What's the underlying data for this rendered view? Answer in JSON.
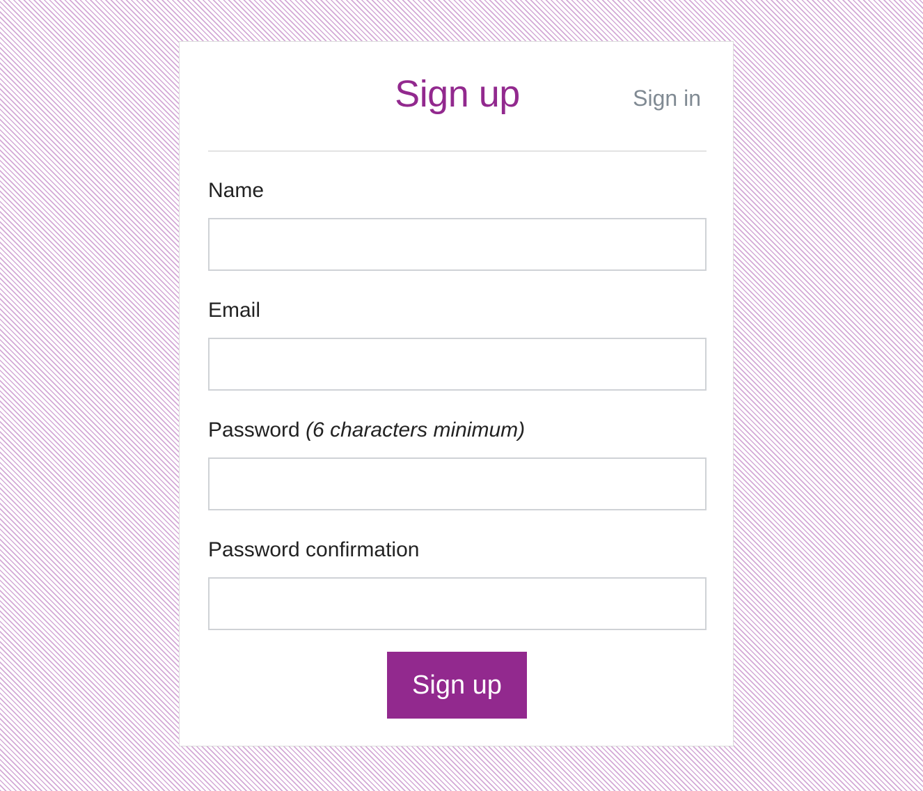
{
  "header": {
    "title": "Sign up",
    "signin_link": "Sign in"
  },
  "form": {
    "fields": [
      {
        "label": "Name",
        "hint": "",
        "value": "",
        "placeholder": ""
      },
      {
        "label": "Email",
        "hint": "",
        "value": "",
        "placeholder": ""
      },
      {
        "label": "Password",
        "hint": "(6 characters minimum)",
        "value": "",
        "placeholder": ""
      },
      {
        "label": "Password confirmation",
        "hint": "",
        "value": "",
        "placeholder": ""
      }
    ],
    "submit_label": "Sign up"
  },
  "colors": {
    "accent": "#92298e",
    "link_gray": "#808a93",
    "background_stripe": "#d3a9d6"
  }
}
